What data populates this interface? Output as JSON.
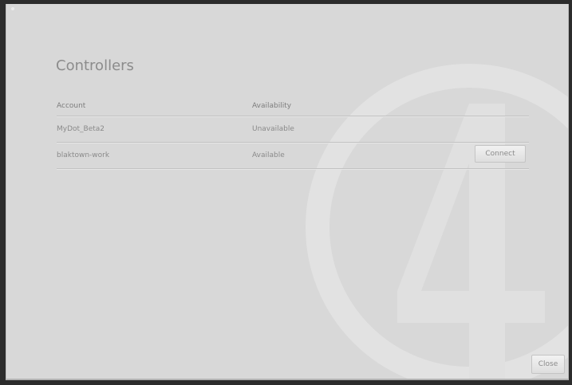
{
  "dialog": {
    "title": "Controllers",
    "close_label": "Close"
  },
  "table": {
    "columns": [
      "Account",
      "Availability"
    ],
    "rows": [
      {
        "account": "MyDot_Beta2",
        "availability": "Unavailable",
        "action_label": ""
      },
      {
        "account": "blaktown-work",
        "availability": "Available",
        "action_label": "Connect"
      }
    ]
  },
  "icons": {
    "watermark": "logo-watermark-icon"
  },
  "colors": {
    "background": "#d8d8d8",
    "text": "#8a8a8a",
    "title": "#8c8c8c"
  }
}
